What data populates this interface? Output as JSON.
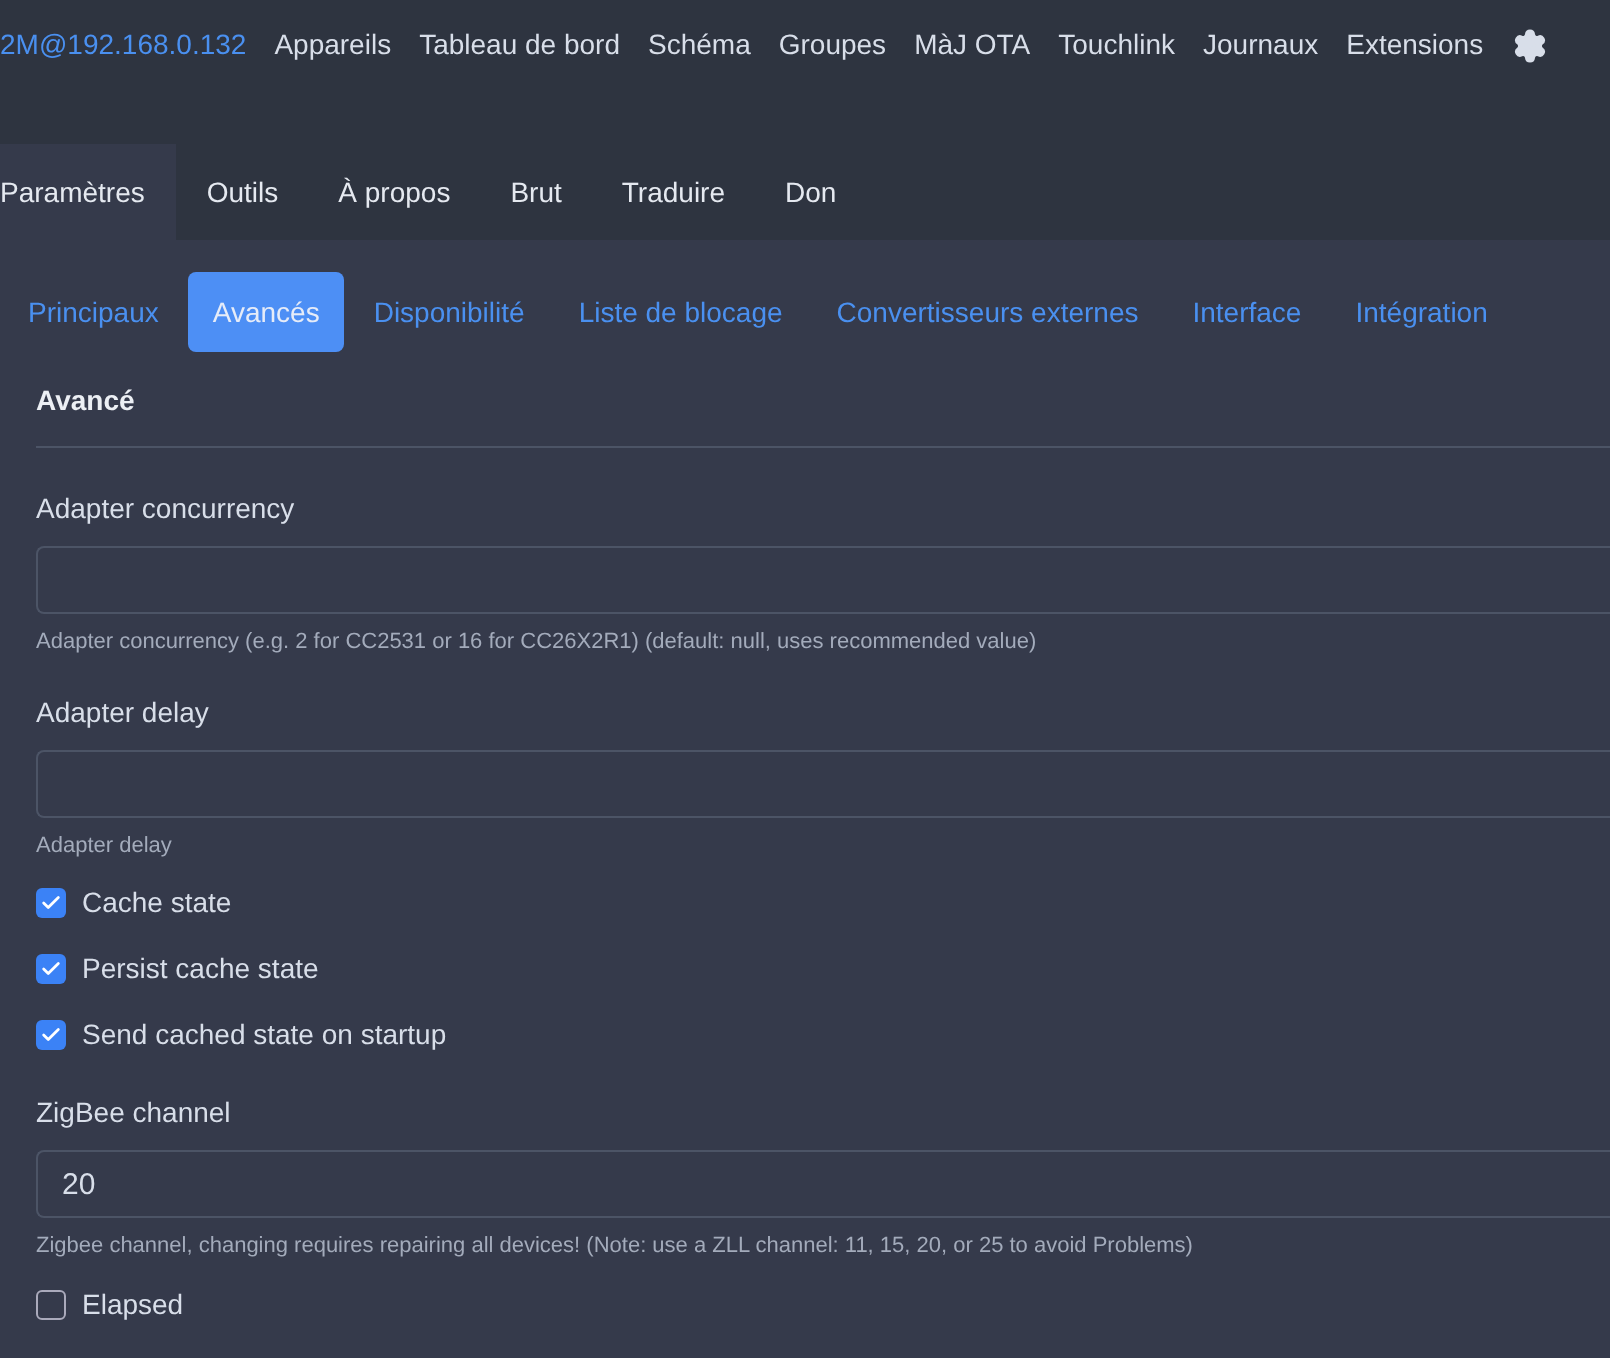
{
  "navbar": {
    "brand": "2M@192.168.0.132",
    "links": [
      "Appareils",
      "Tableau de bord",
      "Schéma",
      "Groupes",
      "MàJ OTA",
      "Touchlink",
      "Journaux",
      "Extensions"
    ]
  },
  "main_tabs": [
    {
      "label": "Paramètres",
      "selected": true
    },
    {
      "label": "Outils",
      "selected": false
    },
    {
      "label": "À propos",
      "selected": false
    },
    {
      "label": "Brut",
      "selected": false
    },
    {
      "label": "Traduire",
      "selected": false
    },
    {
      "label": "Don",
      "selected": false
    }
  ],
  "sub_tabs": [
    {
      "label": "Principaux",
      "selected": false
    },
    {
      "label": "Avancés",
      "selected": true
    },
    {
      "label": "Disponibilité",
      "selected": false
    },
    {
      "label": "Liste de blocage",
      "selected": false
    },
    {
      "label": "Convertisseurs externes",
      "selected": false
    },
    {
      "label": "Interface",
      "selected": false
    },
    {
      "label": "Intégration",
      "selected": false
    }
  ],
  "section_title": "Avancé",
  "fields": [
    {
      "kind": "input",
      "label": "Adapter concurrency",
      "help": "Adapter concurrency (e.g. 2 for CC2531 or 16 for CC26X2R1) (default: null, uses recommended value)"
    },
    {
      "kind": "input",
      "label": "Adapter delay",
      "help": "Adapter delay"
    },
    {
      "kind": "checkbox",
      "label": "Cache state",
      "checked": true
    },
    {
      "kind": "checkbox",
      "label": "Persist cache state",
      "checked": true
    },
    {
      "kind": "checkbox",
      "label": "Send cached state on startup",
      "checked": true
    },
    {
      "kind": "input",
      "label": "ZigBee channel",
      "value": "20",
      "help": "Zigbee channel, changing requires repairing all devices! (Note: use a ZLL channel: 11, 15, 20, or 25 to avoid Problems)"
    },
    {
      "kind": "checkbox",
      "label": "Elapsed",
      "checked": false
    }
  ]
}
